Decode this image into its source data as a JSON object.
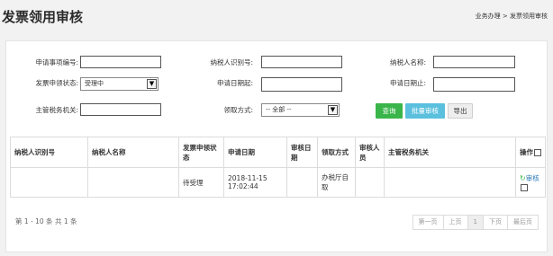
{
  "header": {
    "title": "发票领用审核",
    "breadcrumb": "业务办理 > 发票领用审核"
  },
  "filters": {
    "app_no_label": "申请事项编号:",
    "app_no_value": "",
    "taxpayer_id_label": "纳税人识别号:",
    "taxpayer_id_value": "",
    "taxpayer_name_label": "纳税人名称:",
    "taxpayer_name_value": "",
    "status_label": "发票申领状态:",
    "status_value": "受理中",
    "date_start_label": "申请日期起:",
    "date_start_value": "",
    "date_end_label": "申请日期止:",
    "date_end_value": "",
    "authority_label": "主管税务机关:",
    "authority_value": "",
    "method_label": "领取方式:",
    "method_value": "-- 全部 --"
  },
  "buttons": {
    "query": "查询",
    "batch_audit": "批量审核",
    "export": "导出"
  },
  "table": {
    "headers": [
      "纳税人识别号",
      "纳税人名称",
      "发票申领状态",
      "申请日期",
      "审核日期",
      "领取方式",
      "审核人员",
      "主管税务机关",
      "操作"
    ],
    "rows": [
      {
        "taxpayer_id": "",
        "taxpayer_name": "",
        "status": "待受理",
        "apply_date": "2018-11-15 17:02:44",
        "audit_date": "",
        "method": "办税厅自取",
        "auditor": "",
        "authority": "",
        "action": "审核"
      }
    ]
  },
  "pager": {
    "info": "第 1 - 10 条 共 1 条",
    "first": "第一页",
    "prev": "上页",
    "current": "1",
    "next": "下页",
    "last": "最后页"
  },
  "icons": {
    "refresh": "refresh-icon",
    "dropdown": "chevron-down-icon"
  },
  "colors": {
    "query_button": "#3ab54a",
    "batch_button": "#5bc0de",
    "link": "#2a7ab8"
  }
}
